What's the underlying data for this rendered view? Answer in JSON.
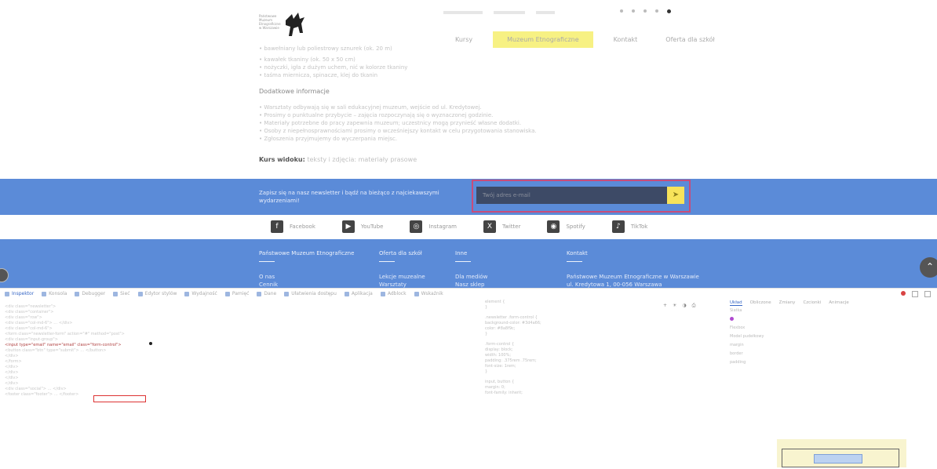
{
  "header": {
    "logo_text": "Państwowe Muzeum Etnograficzne w Warszawie",
    "nav": [
      "Kursy",
      "Muzeum Etnograficzne",
      "Kontakt",
      "Oferta dla szkół"
    ],
    "active_nav_index": 1
  },
  "content": {
    "intro_lines": [
      "• bawełniany lub poliestrowy sznurek (ok. 20 m)",
      "• kawałek tkaniny (ok. 50 x 50 cm)",
      "• nożyczki, igła z dużym uchem, nić w kolorze tkaniny",
      "• taśma miernicza, spinacze, klej do tkanin"
    ],
    "section_heading": "Dodatkowe informacje",
    "detail_lines": [
      "• Warsztaty odbywają się w sali edukacyjnej muzeum, wejście od ul. Kredytowej.",
      "• Prosimy o punktualne przybycie – zajęcia rozpoczynają się o wyznaczonej godzinie.",
      "• Materiały potrzebne do pracy zapewnia muzeum; uczestnicy mogą przynieść własne dodatki.",
      "• Osoby z niepełnosprawnościami prosimy o wcześniejszy kontakt w celu przygotowania stanowiska.",
      "• Zgłoszenia przyjmujemy do wyczerpania miejsc."
    ],
    "source_label": "Kurs widoku:",
    "source_value": "teksty i zdjęcia: materiały prasowe"
  },
  "newsletter": {
    "text": "Zapisz się na nasz newsletter i bądź na bieżąco z najciekawszymi wydarzeniami!",
    "input_placeholder": "Twój adres e-mail",
    "submit_icon": "send-icon"
  },
  "social": [
    {
      "label": "Facebook",
      "icon": "facebook-icon",
      "glyph": "f"
    },
    {
      "label": "YouTube",
      "icon": "youtube-icon",
      "glyph": "▶"
    },
    {
      "label": "Instagram",
      "icon": "instagram-icon",
      "glyph": "◎"
    },
    {
      "label": "Twitter",
      "icon": "x-icon",
      "glyph": "X"
    },
    {
      "label": "Spotify",
      "icon": "spotify-icon",
      "glyph": "◉"
    },
    {
      "label": "TikTok",
      "icon": "tiktok-icon",
      "glyph": "♪"
    }
  ],
  "footer": {
    "cols": [
      {
        "heading": "Państwowe Muzeum Etnograficzne",
        "links": [
          "O nas",
          "Cennik"
        ]
      },
      {
        "heading": "Oferta dla szkół",
        "links": [
          "Lekcje muzealne",
          "Warsztaty"
        ]
      },
      {
        "heading": "Inne",
        "links": [
          "Dla mediów",
          "Nasz sklep"
        ]
      },
      {
        "heading": "Kontakt",
        "links": [
          "Państwowe Muzeum Etnograficzne w Warszawie",
          "ul. Kredytowa 1, 00-056 Warszawa"
        ]
      }
    ]
  },
  "devtools": {
    "tabs": [
      "Inspektor",
      "Konsola",
      "Debugger",
      "Sieć",
      "Edytor stylów",
      "Wydajność",
      "Pamięć",
      "Dane",
      "Ułatwienia dostępu",
      "Aplikacja",
      "Adblock",
      "Wskaźnik"
    ],
    "dom_lines": [
      "<div class=\"newsletter\">",
      "  <div class=\"container\">",
      "    <div class=\"row\">",
      "      <div class=\"col-md-6\"> … </div>",
      "      <div class=\"col-md-6\">",
      "        <form class=\"newsletter-form\" action=\"#\" method=\"post\">",
      "          <div class=\"input-group\">",
      "            <input type=\"email\" name=\"email\" class=\"form-control\">",
      "            <button class=\"btn\" type=\"submit\"> … </button>",
      "          </div>",
      "        </form>",
      "      </div>",
      "    </div>",
      "  </div>",
      "</div>",
      "<div class=\"social\"> … </div>",
      "<footer class=\"footer\"> … </footer>"
    ],
    "styles_lines": [
      "element {",
      "}",
      ".newsletter .form-control {",
      "  background-color: #3d4a66;",
      "  color: #8a8f9c;",
      "}",
      ".form-control {",
      "  display: block;",
      "  width: 100%;",
      "  padding: .375rem .75rem;",
      "  font-size: 1rem;",
      "}",
      "input, button {",
      "  margin: 0;",
      "  font-family: inherit;",
      "}"
    ],
    "computed_tabs": [
      "Układ",
      "Obliczone",
      "Zmiany",
      "Czcionki",
      "Animacje"
    ],
    "computed_rows": [
      "Siatka",
      "Flexbox",
      "Model pudełkowy",
      "margin",
      "border",
      "padding"
    ]
  }
}
